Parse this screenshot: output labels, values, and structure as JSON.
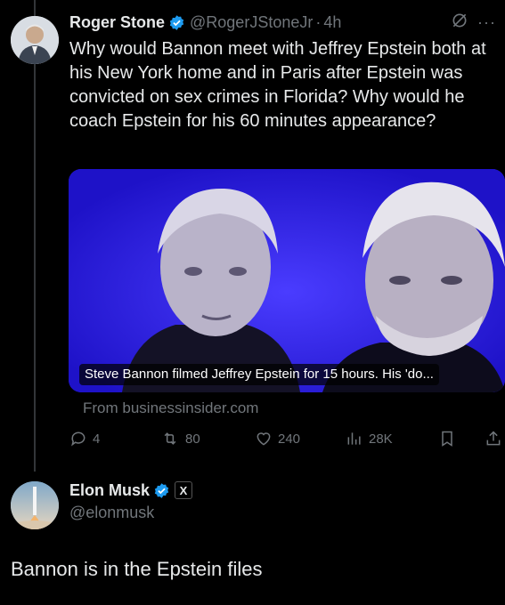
{
  "tweet1": {
    "name": "Roger Stone",
    "handle": "@RogerJStoneJr",
    "dot": "·",
    "time": "4h",
    "more": "···",
    "text": "Why would Bannon meet with Jeffrey Epstein both at his New York home and in Paris after Epstein was convicted on sex crimes in Florida? Why would he coach Epstein for his 60 minutes appearance?",
    "card": {
      "caption": "Steve Bannon filmed Jeffrey Epstein for 15 hours. His 'do...",
      "source": "From businessinsider.com"
    },
    "actions": {
      "replies": "4",
      "reposts": "80",
      "likes": "240",
      "views": "28K"
    },
    "colors": {
      "verified": "#1d9bf0",
      "card_background": "#2a1ee0",
      "muted": "#71767b"
    }
  },
  "tweet2": {
    "name": "Elon Musk",
    "badge": "X",
    "handle": "@elonmusk",
    "text": "Bannon is in the Epstein files"
  },
  "icons": {
    "verified": "verified-badge-icon",
    "grok": "grok-icon",
    "reply": "reply-icon",
    "repost": "repost-icon",
    "like": "heart-icon",
    "views": "views-icon",
    "bookmark": "bookmark-icon",
    "share": "share-icon"
  }
}
